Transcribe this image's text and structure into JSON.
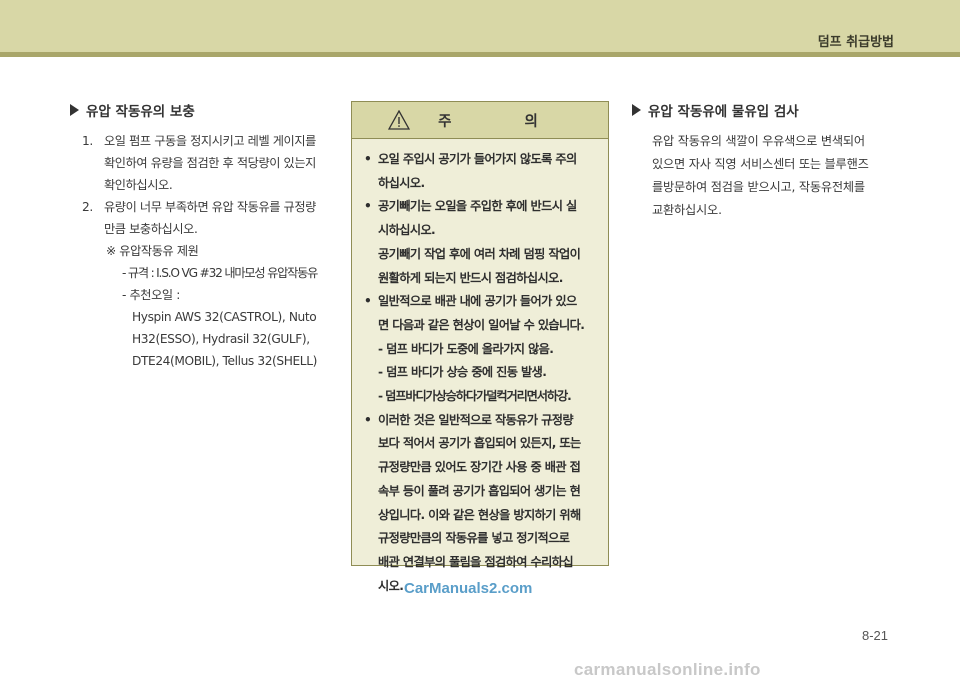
{
  "header": {
    "title": "덤프 취급방법",
    "band_color": "#d8d7a6",
    "line_color": "#a9a66a"
  },
  "left": {
    "title": "유압 작동유의 보충",
    "items": [
      {
        "num": "1.",
        "lines": [
          "오일 펌프 구동을 정지시키고 레벨 게이지를",
          "확인하여 유량을 점검한 후 적당량이 있는지",
          "확인하십시오."
        ]
      },
      {
        "num": "2.",
        "lines": [
          "유량이 너무 부족하면 유압 작동유를 규정량",
          "만큼 보충하십시오."
        ]
      }
    ],
    "spec": {
      "head": "※ 유압작동유 제원",
      "standard": "- 규격 : I.S.O VG #32 내마모성 유압작동유",
      "recommended": "- 추천오일 :",
      "oils": [
        "Hyspin AWS 32(CASTROL), Nuto",
        "H32(ESSO), Hydrasil 32(GULF),",
        "DTE24(MOBIL), Tellus 32(SHELL)"
      ]
    }
  },
  "caution": {
    "title": "주 의",
    "icon": "warning-triangle-icon",
    "bg_color": "#efeed8",
    "items": [
      {
        "bullet": "•",
        "lines": [
          "오일 주입시 공기가 들어가지 않도록 주의",
          "하십시오."
        ],
        "sub": [],
        "dashes": []
      },
      {
        "bullet": "•",
        "lines": [
          "공기빼기는 오일을 주입한 후에 반드시 실",
          "시하십시오."
        ],
        "sub": [
          "공기빼기 작업 후에 여러 차례 덤핑 작업이",
          "원활하게 되는지 반드시 점검하십시오."
        ],
        "dashes": []
      },
      {
        "bullet": "•",
        "lines": [
          "일반적으로 배관 내에 공기가 들어가 있으",
          "면 다음과 같은 현상이 일어날 수 있습니다."
        ],
        "sub": [],
        "dashes": [
          "- 덤프 바디가 도중에 올라가지 않음.",
          "- 덤프 바디가 상승 중에 진동 발생.",
          "- 덤프바디가상승하다가덜컥거리면서하강."
        ]
      },
      {
        "bullet": "•",
        "lines": [
          "이러한 것은 일반적으로 작동유가 규정량",
          "보다 적어서 공기가 흡입되어 있든지, 또는",
          "규정량만큼 있어도 장기간 사용 중 배관 접",
          "속부 등이 풀려 공기가 흡입되어 생기는 현",
          "상입니다. 이와 같은 현상을 방지하기 위해",
          "규정량만큼의 작동유를 넣고 정기적으로",
          "배관 연결부의 풀림을 점검하여 수리하십",
          "시오."
        ],
        "sub": [],
        "dashes": []
      }
    ]
  },
  "right": {
    "title": "유압 작동유에 물유입 검사",
    "lines": [
      "유압 작동유의 색깔이 우유색으로 변색되어",
      "있으면 자사 직영 서비스센터 또는 블루핸즈",
      "를방문하여 점검을 받으시고, 작동유전체를",
      "교환하십시오."
    ]
  },
  "footer": {
    "page": "8-21",
    "watermark_top": "CarManuals2.com",
    "watermark_bottom": "carmanualsonline.info"
  }
}
